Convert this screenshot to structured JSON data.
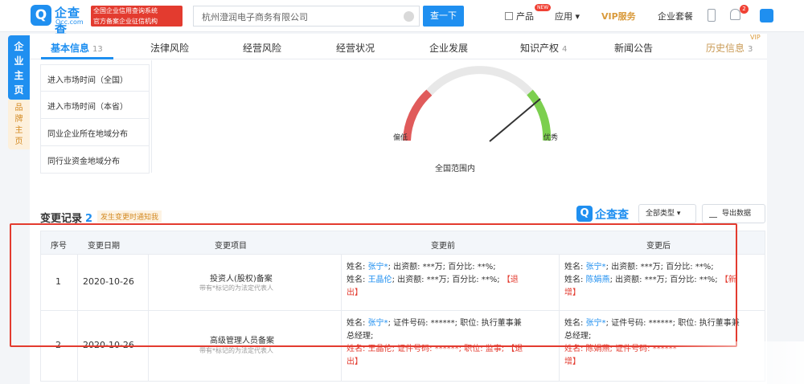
{
  "header": {
    "logo_mark": "Q",
    "logo_name": "企查查",
    "logo_sub": "Qcc.com",
    "gov_badge_line1": "全国企业信用查询系统",
    "gov_badge_line2": "官方备案企业征信机构",
    "search_value": "杭州澄润电子商务有限公司",
    "search_button": "查一下",
    "nav": [
      {
        "label": "产品"
      },
      {
        "label": "应用 ▾"
      },
      {
        "label": "VIP服务"
      },
      {
        "label": "企业套餐"
      }
    ],
    "new_badge": "NEW",
    "notification_count": "2"
  },
  "sidebar": {
    "main_tab": "企业主页",
    "brand_tab": "品牌主页"
  },
  "tabs": [
    {
      "label": "基本信息",
      "count": "13"
    },
    {
      "label": "法律风险",
      "count": ""
    },
    {
      "label": "经营风险",
      "count": ""
    },
    {
      "label": "经营状况",
      "count": ""
    },
    {
      "label": "企业发展",
      "count": ""
    },
    {
      "label": "知识产权",
      "count": "4"
    },
    {
      "label": "新闻公告",
      "count": ""
    },
    {
      "label": "历史信息",
      "count": "3"
    }
  ],
  "vip_mark": "VIP",
  "side_list": [
    "进入市场时间（全国）",
    "进入市场时间（本省）",
    "同业企业所在地域分布",
    "同行业资金地域分布"
  ],
  "gauge": {
    "low": "偏低",
    "high": "优秀",
    "label": "全国范围内"
  },
  "section": {
    "title": "变更记录",
    "count": "2",
    "note": "发生变更时通知我",
    "brand": "企查查",
    "select_label": "全部类型 ▾",
    "export_label": "导出数据"
  },
  "table": {
    "headers": [
      "序号",
      "变更日期",
      "变更项目",
      "变更前",
      "变更后"
    ],
    "rows": [
      {
        "num": "1",
        "date": "2020-10-26",
        "item": "投资人(股权)备案",
        "item_sub": "带有*标记的为法定代表人",
        "before": [
          {
            "parts": [
              {
                "t": "姓名: ",
                "c": "k"
              },
              {
                "t": "张宁*",
                "c": "link"
              },
              {
                "t": "; 出资额: ***万; 百分比: **%;",
                "c": "k"
              }
            ]
          },
          {
            "parts": [
              {
                "t": "姓名: ",
                "c": "k"
              },
              {
                "t": "王晶伦",
                "c": "link"
              },
              {
                "t": "; 出资额: ***万; 百分比: **%; ",
                "c": "k"
              },
              {
                "t": "【退",
                "c": "red"
              }
            ]
          },
          {
            "parts": [
              {
                "t": "出】",
                "c": "red"
              }
            ]
          }
        ],
        "after": [
          {
            "parts": [
              {
                "t": "姓名: ",
                "c": "k"
              },
              {
                "t": "张宁*",
                "c": "link"
              },
              {
                "t": "; 出资额: ***万; 百分比: **%;",
                "c": "k"
              }
            ]
          },
          {
            "parts": [
              {
                "t": "姓名: ",
                "c": "k"
              },
              {
                "t": "陈娟燕",
                "c": "link"
              },
              {
                "t": "; 出资额: ***万; 百分比: **%; ",
                "c": "k"
              },
              {
                "t": "【新",
                "c": "red"
              }
            ]
          },
          {
            "parts": [
              {
                "t": "增】",
                "c": "red"
              }
            ]
          }
        ]
      },
      {
        "num": "2",
        "date": "2020-10-26",
        "item": "高级管理人员备案",
        "item_sub": "带有*标记的为法定代表人",
        "before": [
          {
            "parts": [
              {
                "t": "姓名: ",
                "c": "k"
              },
              {
                "t": "张宁*",
                "c": "link"
              },
              {
                "t": "; 证件号码: ******; 职位: 执行董事兼",
                "c": "k"
              }
            ]
          },
          {
            "parts": [
              {
                "t": "总经理;",
                "c": "k"
              }
            ]
          },
          {
            "parts": [
              {
                "t": "姓名: 王晶伦; 证件号码: ******; 职位: 监事; 【退",
                "c": "red"
              }
            ]
          },
          {
            "parts": [
              {
                "t": "出】",
                "c": "red"
              }
            ]
          }
        ],
        "after": [
          {
            "parts": [
              {
                "t": "姓名: ",
                "c": "k"
              },
              {
                "t": "张宁*",
                "c": "link"
              },
              {
                "t": "; 证件号码: ******; 职位: 执行董事兼",
                "c": "k"
              }
            ]
          },
          {
            "parts": [
              {
                "t": "总经理;",
                "c": "k"
              }
            ]
          },
          {
            "parts": [
              {
                "t": "姓名: 陈娟燕; 证件号码: ******",
                "c": "red"
              }
            ]
          },
          {
            "parts": [
              {
                "t": "增】",
                "c": "red"
              }
            ]
          }
        ]
      }
    ]
  },
  "colors": {
    "brand": "#1f8ff0",
    "alert": "#e33b2f",
    "gold": "#d99a3b"
  }
}
